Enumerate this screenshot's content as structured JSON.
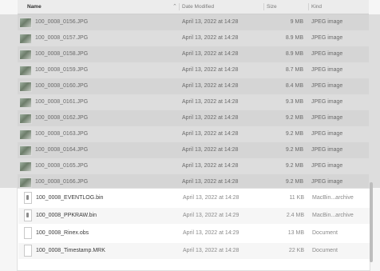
{
  "header": {
    "name": "Name",
    "date_modified": "Date Modified",
    "size": "Size",
    "kind": "Kind"
  },
  "files_top": [
    {
      "name": "100_0008_0156.JPG",
      "date": "April 13, 2022 at 14:28",
      "size": "9 MB",
      "kind": "JPEG image"
    },
    {
      "name": "100_0008_0157.JPG",
      "date": "April 13, 2022 at 14:28",
      "size": "8.9 MB",
      "kind": "JPEG image"
    },
    {
      "name": "100_0008_0158.JPG",
      "date": "April 13, 2022 at 14:28",
      "size": "8.9 MB",
      "kind": "JPEG image"
    },
    {
      "name": "100_0008_0159.JPG",
      "date": "April 13, 2022 at 14:28",
      "size": "8.7 MB",
      "kind": "JPEG image"
    },
    {
      "name": "100_0008_0160.JPG",
      "date": "April 13, 2022 at 14:28",
      "size": "8.4 MB",
      "kind": "JPEG image"
    },
    {
      "name": "100_0008_0161.JPG",
      "date": "April 13, 2022 at 14:28",
      "size": "9.3 MB",
      "kind": "JPEG image"
    },
    {
      "name": "100_0008_0162.JPG",
      "date": "April 13, 2022 at 14:28",
      "size": "9.2 MB",
      "kind": "JPEG image"
    },
    {
      "name": "100_0008_0163.JPG",
      "date": "April 13, 2022 at 14:28",
      "size": "9.2 MB",
      "kind": "JPEG image"
    },
    {
      "name": "100_0008_0164.JPG",
      "date": "April 13, 2022 at 14:28",
      "size": "9.2 MB",
      "kind": "JPEG image"
    },
    {
      "name": "100_0008_0165.JPG",
      "date": "April 13, 2022 at 14:28",
      "size": "9.2 MB",
      "kind": "JPEG image"
    },
    {
      "name": "100_0008_0166.JPG",
      "date": "April 13, 2022 at 14:28",
      "size": "9.2 MB",
      "kind": "JPEG image"
    }
  ],
  "files_bottom": [
    {
      "name": "100_0008_EVENTLOG.bin",
      "date": "April 13, 2022 at 14:28",
      "size": "11 KB",
      "kind": "MacBin...archive",
      "icon": "bin-file-icon"
    },
    {
      "name": "100_0008_PPKRAW.bin",
      "date": "April 13, 2022 at 14:29",
      "size": "2.4 MB",
      "kind": "MacBin...archive",
      "icon": "bin-file-icon"
    },
    {
      "name": "100_0008_Rinex.obs",
      "date": "April 13, 2022 at 14:29",
      "size": "13 MB",
      "kind": "Document",
      "icon": "document-icon"
    },
    {
      "name": "100_0008_Timestamp.MRK",
      "date": "April 13, 2022 at 14:28",
      "size": "22 KB",
      "kind": "Document",
      "icon": "document-icon"
    }
  ]
}
